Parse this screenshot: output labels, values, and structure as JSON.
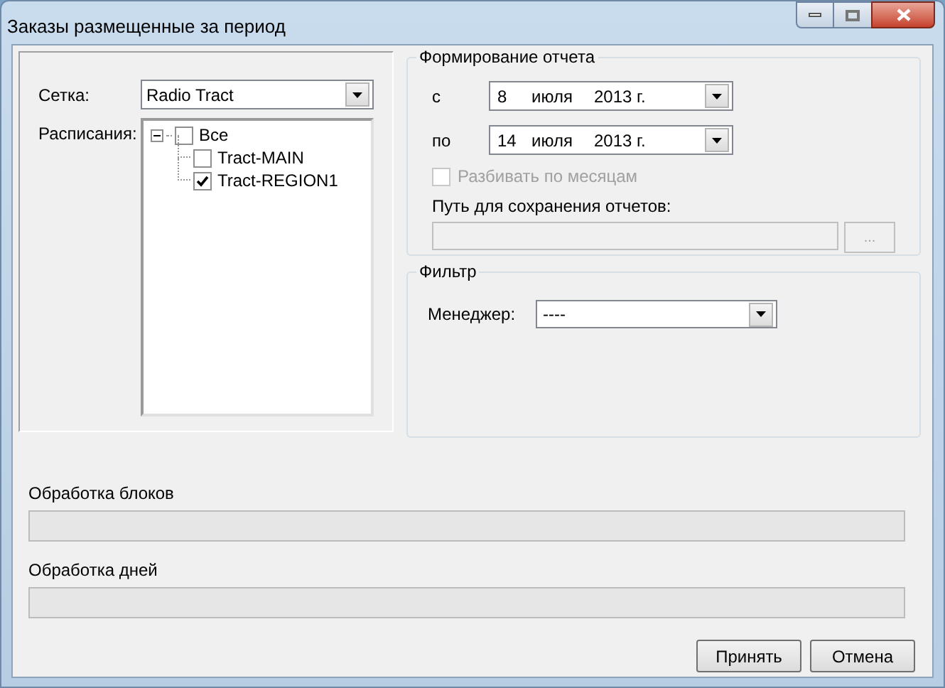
{
  "window": {
    "title": "Заказы размещенные за период"
  },
  "grid": {
    "label": "Сетка:",
    "value": "Radio Tract"
  },
  "schedules": {
    "label": "Расписания:",
    "tree": [
      {
        "label": "Все",
        "checked": false,
        "expanded": true,
        "children": [
          {
            "label": "Tract-MAIN",
            "checked": false
          },
          {
            "label": "Tract-REGION1",
            "checked": true
          }
        ]
      }
    ]
  },
  "report": {
    "title": "Формирование отчета",
    "dates": [
      {
        "label": "с",
        "day": "8",
        "month": "июля",
        "year": "2013 г."
      },
      {
        "label": "по",
        "day": "14",
        "month": "июля",
        "year": "2013 г."
      }
    ],
    "split_by_month": {
      "label": "Разбивать по месяцам",
      "checked": false,
      "disabled": true
    },
    "path": {
      "label": "Путь для сохранения отчетов:",
      "browse": "..."
    }
  },
  "filter": {
    "title": "Фильтр",
    "manager": {
      "label": "Менеджер:",
      "value": "----"
    }
  },
  "progress": [
    {
      "label": "Обработка блоков",
      "level": 0
    },
    {
      "label": "Обработка дней",
      "level": 0
    }
  ],
  "buttons": [
    "Принять",
    "Отмена"
  ]
}
